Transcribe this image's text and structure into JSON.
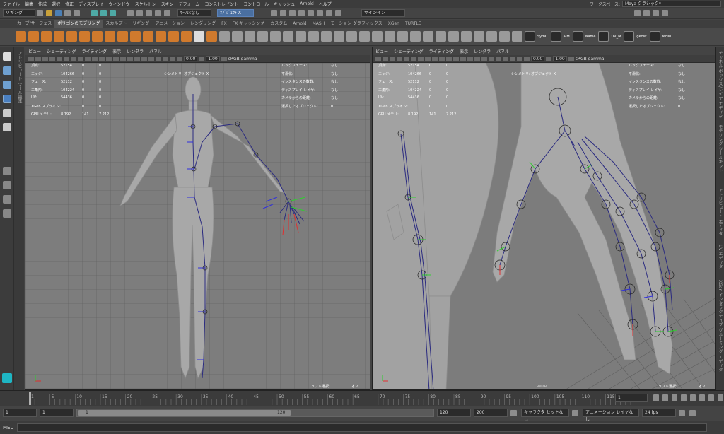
{
  "menubar": [
    "ファイル",
    "編集",
    "作成",
    "選択",
    "修正",
    "ディスプレイ",
    "ウィンドウ",
    "スケルトン",
    "スキン",
    "デフォーム",
    "コンストレイント",
    "コントロール",
    "キャッシュ",
    "Arnold",
    "ヘルプ"
  ],
  "workspace": {
    "label": "ワークスペース:",
    "value": "Moya クラシック*"
  },
  "status": {
    "mode": "リギング",
    "no_live": "ｻｰﾌｪｽなし",
    "symmetry": "ｵﾌﾞｼﾞｪｸﾄ X",
    "sign_in": "サインイン"
  },
  "shelf_tabs": [
    "カーブ/サーフェス",
    "ポリゴンのモデリング",
    "スカルプト",
    "リギング",
    "アニメーション",
    "レンダリング",
    "FX",
    "FX キャッシング",
    "カスタム",
    "Arnold",
    "MASH",
    "モーション グラフィックス",
    "XGen",
    "TURTLE"
  ],
  "shelf_active": 1,
  "shelf_labels": [
    "SymC",
    "AIM",
    "Name",
    "UV_M",
    "geoW",
    "MHM"
  ],
  "left_tabs": [
    "アトリビュート",
    "ツール設定"
  ],
  "right_tabs": [
    "チャネル ボックス/レイヤ エディタ",
    "モデリング ツールキット",
    "アトリビュート エディタ",
    "UV エディタ",
    "XGen インタラクティブ グルーミング エディタ"
  ],
  "viewport_menu": [
    "ビュー",
    "シェーディング",
    "ライティング",
    "表示",
    "レンダラ",
    "パネル"
  ],
  "viewport_toolbar": {
    "val1": "0.00",
    "val2": "1.00",
    "colorspace": "sRGB gamma"
  },
  "hud_left": [
    {
      "k": "頂点:",
      "a": "52154",
      "b": "0",
      "c": "0"
    },
    {
      "k": "エッジ:",
      "a": "104266",
      "b": "0",
      "c": "0"
    },
    {
      "k": "フェース:",
      "a": "52112",
      "b": "0",
      "c": "0"
    },
    {
      "k": "三角形:",
      "a": "104224",
      "b": "0",
      "c": "0"
    },
    {
      "k": "UV:",
      "a": "54436",
      "b": "0",
      "c": "0"
    },
    {
      "k": "XGen スプライン:",
      "a": "",
      "b": "0",
      "c": "0"
    },
    {
      "k": "GPU メモリ:",
      "a": "8 192",
      "b": "141",
      "c": "7 212"
    }
  ],
  "hud_right": [
    {
      "k": "バックフェース:",
      "v": "なし"
    },
    {
      "k": "平滑化:",
      "v": "なし"
    },
    {
      "k": "インスタンスの数数:",
      "v": "なし"
    },
    {
      "k": "ディスプレイ レイヤ:",
      "v": "なし"
    },
    {
      "k": "カメラからの距離:",
      "v": "なし"
    },
    {
      "k": "選択したオブジェクト:",
      "v": "0"
    }
  ],
  "hud_symmetry": "シンメトリ: オブジェクト X",
  "hud_soft": {
    "label": "ソフト選択:",
    "value": "オフ"
  },
  "hud_camera": "persp",
  "timeline": {
    "ticks": [
      "1",
      "5",
      "10",
      "15",
      "20",
      "25",
      "30",
      "35",
      "40",
      "45",
      "50",
      "55",
      "60",
      "65",
      "70",
      "75",
      "80",
      "85",
      "90",
      "95",
      "100",
      "105",
      "110",
      "115",
      "120"
    ],
    "current": "1"
  },
  "range": {
    "start": "1",
    "start2": "1",
    "inner_start": "1",
    "inner_end": "120",
    "end": "120",
    "end2": "200",
    "char_set": "キャラクタ セットなし",
    "anim_layer": "アニメーション レイヤなし",
    "fps": "24 fps"
  },
  "cmd": {
    "label": "MEL"
  }
}
